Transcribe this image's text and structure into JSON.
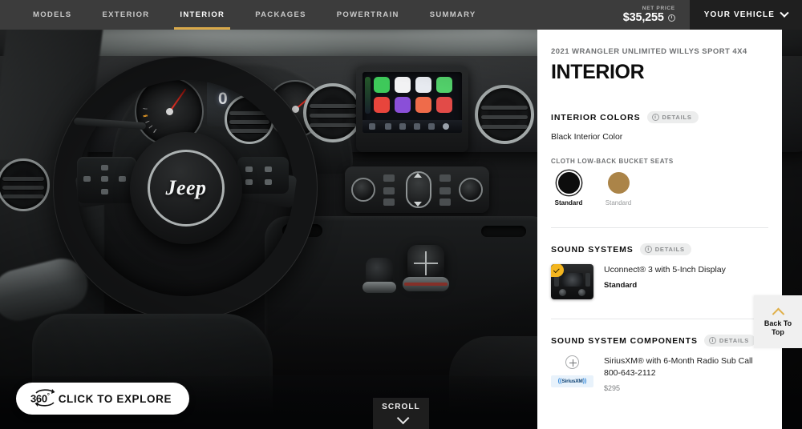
{
  "nav": {
    "items": [
      {
        "label": "MODELS",
        "active": false
      },
      {
        "label": "EXTERIOR",
        "active": false
      },
      {
        "label": "INTERIOR",
        "active": true
      },
      {
        "label": "PACKAGES",
        "active": false
      },
      {
        "label": "POWERTRAIN",
        "active": false
      },
      {
        "label": "SUMMARY",
        "active": false
      }
    ],
    "price_label": "NET PRICE",
    "price_value": "$35,255",
    "price_info_icon": "info-circle-icon",
    "vehicle_button": "YOUR VEHICLE",
    "vehicle_chevron_icon": "chevron-down-icon",
    "active_underline_color": "#d9a94a"
  },
  "panel": {
    "subtitle": "2021 WRANGLER UNLIMITED WILLYS SPORT 4X4",
    "title": "INTERIOR",
    "details_pill": {
      "label": "DETAILS",
      "icon": "info-circle-icon"
    },
    "interior_colors": {
      "heading": "INTERIOR COLORS",
      "selected_text": "Black Interior Color",
      "group_label": "CLOTH LOW-BACK BUCKET SEATS",
      "swatches": [
        {
          "name": "black-interior-swatch",
          "color": "#0d0d0d",
          "label": "Standard",
          "selected": true
        },
        {
          "name": "tan-interior-swatch",
          "color": "#ab8448",
          "label": "Standard",
          "selected": false
        }
      ]
    },
    "sound_systems": {
      "heading": "SOUND SYSTEMS",
      "items": [
        {
          "name": "Uconnect® 3 with 5-Inch Display",
          "status": "Standard",
          "selected": true,
          "badge_icon": "check-badge-icon",
          "thumbnail": "uconnect-radio-thumbnail"
        }
      ]
    },
    "sound_system_components": {
      "heading": "SOUND SYSTEM COMPONENTS",
      "items": [
        {
          "name": "SiriusXM® with 6-Month Radio Sub Call 800-643-2112",
          "price": "$295",
          "add_icon": "plus-circle-icon",
          "logo_text": "SiriusXM",
          "logo_mark": "siriusxm-logo"
        }
      ]
    }
  },
  "back_to_top": {
    "label": "Back To\nTop",
    "line1": "Back To",
    "line2": "Top",
    "icon": "chevron-up-icon",
    "icon_color": "#e0b04a"
  },
  "explore_button": {
    "number": "360",
    "degree": "°",
    "label": "CLICK TO EXPLORE",
    "icon": "rotate-360-icon"
  },
  "scroll_indicator": {
    "label": "SCROLL",
    "icon": "chevron-down-icon"
  },
  "hero": {
    "name": "jeep-wrangler-interior-photo",
    "brand_logo_text": "Jeep",
    "cluster_value": "0"
  }
}
